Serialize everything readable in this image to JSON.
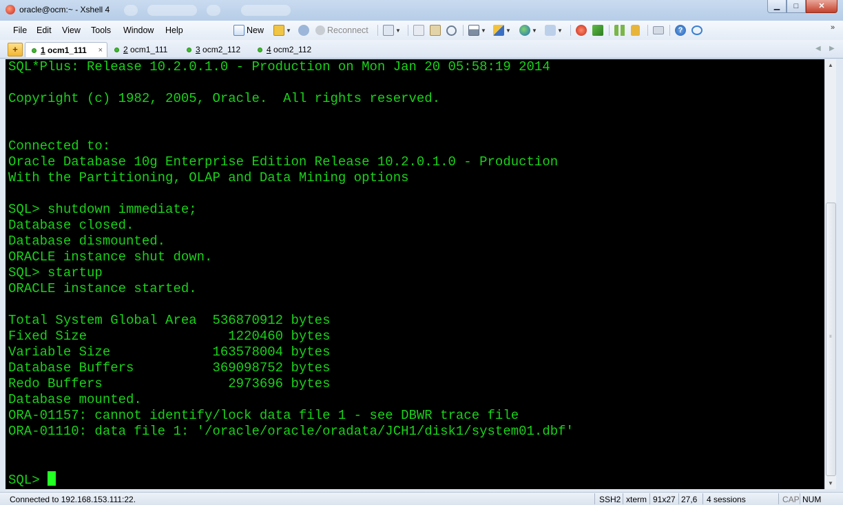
{
  "window": {
    "title": "oracle@ocm:~ - Xshell 4",
    "minimize_glyph": "▁",
    "maximize_glyph": "□",
    "close_glyph": "✕"
  },
  "menu": [
    "File",
    "Edit",
    "View",
    "Tools",
    "Window",
    "Help"
  ],
  "toolbar": {
    "new_label": "New",
    "reconnect_label": "Reconnect",
    "icons": [
      "new-session-icon",
      "open-folder-icon",
      "reconnect-icon",
      "properties-icon",
      "copy-icon",
      "paste-icon",
      "find-icon",
      "print-icon",
      "transfer-icon",
      "globe-icon",
      "font-icon",
      "xftp-icon",
      "script-icon",
      "layout-icon",
      "lock-icon",
      "keyboard-icon",
      "help-icon",
      "chat-icon"
    ]
  },
  "tabs": [
    {
      "num": "1",
      "name": "ocm1_111",
      "active": true,
      "close": "×"
    },
    {
      "num": "2",
      "name": "ocm1_111",
      "active": false
    },
    {
      "num": "3",
      "name": "ocm2_112",
      "active": false
    },
    {
      "num": "4",
      "name": "ocm2_112",
      "active": false
    }
  ],
  "terminal": {
    "lines": [
      "SQL*Plus: Release 10.2.0.1.0 - Production on Mon Jan 20 05:58:19 2014",
      "",
      "Copyright (c) 1982, 2005, Oracle.  All rights reserved.",
      "",
      "",
      "Connected to:",
      "Oracle Database 10g Enterprise Edition Release 10.2.0.1.0 - Production",
      "With the Partitioning, OLAP and Data Mining options",
      "",
      "SQL> shutdown immediate;",
      "Database closed.",
      "Database dismounted.",
      "ORACLE instance shut down.",
      "SQL> startup",
      "ORACLE instance started.",
      "",
      "Total System Global Area  536870912 bytes",
      "Fixed Size                  1220460 bytes",
      "Variable Size             163578004 bytes",
      "Database Buffers          369098752 bytes",
      "Redo Buffers                2973696 bytes",
      "Database mounted.",
      "ORA-01157: cannot identify/lock data file 1 - see DBWR trace file",
      "ORA-01110: data file 1: '/oracle/oracle/oradata/JCH1/disk1/system01.dbf'",
      "",
      ""
    ],
    "prompt": "SQL> ",
    "text_color": "#19d219",
    "background": "#000000"
  },
  "status": {
    "connection": "Connected to 192.168.153.111:22.",
    "protocol": "SSH2",
    "term_type": "xterm",
    "size": "91x27",
    "cursor_pos": "27,6",
    "sessions": "4 sessions",
    "cap": "CAP",
    "num": "NUM"
  }
}
